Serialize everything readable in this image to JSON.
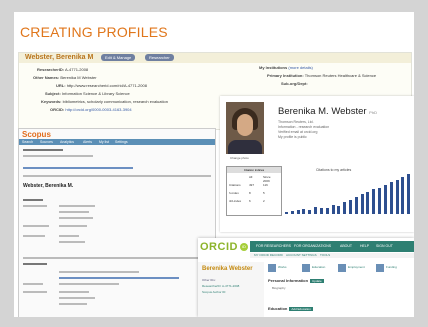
{
  "slide": {
    "title": "CREATING PROFILES"
  },
  "researcherid": {
    "name_line": "Webster, Berenika M",
    "buttons": [
      "Edit & Manage",
      "Researcher"
    ],
    "rows": [
      {
        "label": "ResearcherID:",
        "value": "A-4771-2008"
      },
      {
        "label": "Other Names:",
        "value": "Berenika M Webster"
      },
      {
        "label": "URL:",
        "value": "http://www.researcherid.com/rid/A-4771-2008"
      },
      {
        "label": "Subject:",
        "value": "Information Science & Library Science"
      },
      {
        "label": "Keywords:",
        "value": "bibliometrics, scholarly communication, research evaluation"
      },
      {
        "label": "ORCID:",
        "value": "http://orcid.org/0000-0003-4163-3904"
      }
    ],
    "institution_label": "My Institutions",
    "institution_link": "(more details)",
    "primary_label": "Primary Institution:",
    "primary_value": "Thomson Reuters Healthcare & Science",
    "sub_org_label": "Sub-org/Dept:"
  },
  "scopus": {
    "logo": "Scopus",
    "nav": [
      "Search",
      "Sources",
      "Analytics",
      "Alerts",
      "My list",
      "Settings"
    ],
    "author_name": "Webster, Berenika M."
  },
  "orcid_profile": {
    "name": "Berenika M. Webster",
    "name_suffix": "PhD",
    "sub_lines": [
      "Thomson Reuters, Ltd.",
      "Information - research evaluation",
      "Verified email at orcid.org",
      "My profile is public"
    ],
    "photo_caption": "Change photo",
    "stats_header": "Citation indices",
    "stats_cols": [
      "All",
      "Since 2009"
    ],
    "stats_rows": [
      {
        "label": "Citations",
        "all": "497",
        "since": "116"
      },
      {
        "label": "h-index",
        "all": "8",
        "since": "5"
      },
      {
        "label": "i10-index",
        "all": "6",
        "since": "2"
      }
    ],
    "chart_title": "Citations to my articles",
    "bar_levels": [
      0.06,
      0.08,
      0.1,
      0.12,
      0.1,
      0.18,
      0.16,
      0.14,
      0.22,
      0.2,
      0.3,
      0.34,
      0.42,
      0.5,
      0.55,
      0.62,
      0.66,
      0.72,
      0.8,
      0.85,
      0.92,
      1.0
    ]
  },
  "orcid_record": {
    "logo": "ORCID",
    "id_badge": "iD",
    "nav": [
      "FOR RESEARCHERS",
      "FOR ORGANIZATIONS",
      "ABOUT",
      "HELP",
      "SIGN OUT"
    ],
    "subnav": [
      "MY ORCID RECORD",
      "ACCOUNT SETTINGS",
      "TOOLS"
    ],
    "name": "Berenika Webster",
    "left_lines": [
      "Other IDs:",
      "ResearcherID: A-4771-2008",
      "Scopus Author ID:"
    ],
    "buttons": [
      "Works",
      "Education",
      "Employment",
      "Funding"
    ],
    "sections": [
      {
        "title": "Personal Information",
        "tag": "Update"
      },
      {
        "title": "Education",
        "tag": "Add Education"
      }
    ],
    "biography_label": "Biography"
  }
}
